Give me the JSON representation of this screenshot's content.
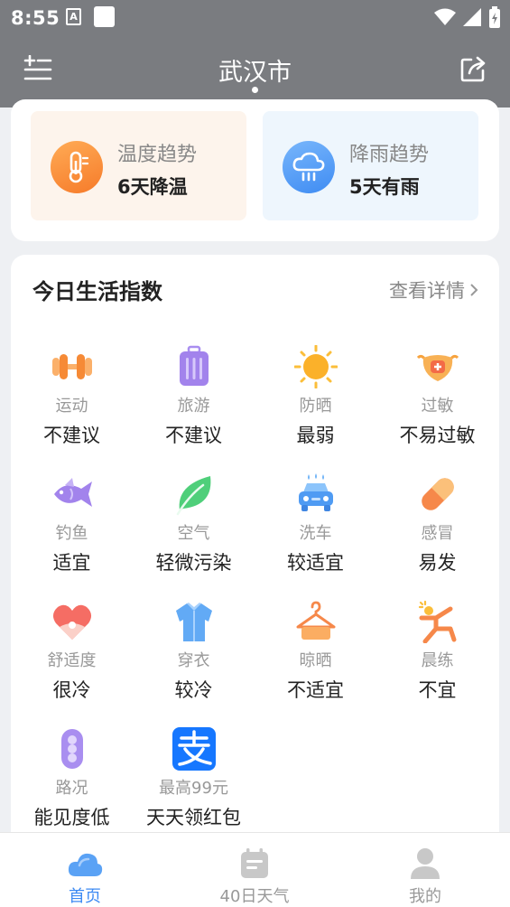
{
  "status_bar": {
    "time": "8:55",
    "notification_letter": "A"
  },
  "header": {
    "title": "武汉市"
  },
  "trends": {
    "temperature": {
      "title": "温度趋势",
      "value": "6天降温"
    },
    "rain": {
      "title": "降雨趋势",
      "value": "5天有雨"
    }
  },
  "life_index": {
    "title": "今日生活指数",
    "detail_link": "查看详情",
    "items": [
      {
        "label": "运动",
        "value": "不建议",
        "icon": "dumbbell-icon"
      },
      {
        "label": "旅游",
        "value": "不建议",
        "icon": "suitcase-icon"
      },
      {
        "label": "防晒",
        "value": "最弱",
        "icon": "sun-icon"
      },
      {
        "label": "过敏",
        "value": "不易过敏",
        "icon": "mask-icon"
      },
      {
        "label": "钓鱼",
        "value": "适宜",
        "icon": "fish-icon"
      },
      {
        "label": "空气",
        "value": "轻微污染",
        "icon": "leaf-icon"
      },
      {
        "label": "洗车",
        "value": "较适宜",
        "icon": "car-wash-icon"
      },
      {
        "label": "感冒",
        "value": "易发",
        "icon": "pill-icon"
      },
      {
        "label": "舒适度",
        "value": "很冷",
        "icon": "heart-icon"
      },
      {
        "label": "穿衣",
        "value": "较冷",
        "icon": "shirt-icon"
      },
      {
        "label": "晾晒",
        "value": "不适宜",
        "icon": "hanger-icon"
      },
      {
        "label": "晨练",
        "value": "不宜",
        "icon": "exercise-icon"
      },
      {
        "label": "路况",
        "value": "能见度低",
        "icon": "traffic-light-icon"
      },
      {
        "label": "最高99元",
        "value": "天天领红包",
        "icon": "alipay-icon"
      }
    ]
  },
  "bottom_nav": {
    "tabs": [
      {
        "label": "首页",
        "icon": "cloud-icon",
        "active": true
      },
      {
        "label": "40日天气",
        "icon": "calendar-icon",
        "active": false
      },
      {
        "label": "我的",
        "icon": "user-icon",
        "active": false
      }
    ]
  },
  "colors": {
    "header_bg": "#7a7c80",
    "accent_blue": "#3d8af3",
    "orange": "#f67b2a",
    "temp_card_bg": "#fdf4ec",
    "rain_card_bg": "#eef6fd"
  }
}
